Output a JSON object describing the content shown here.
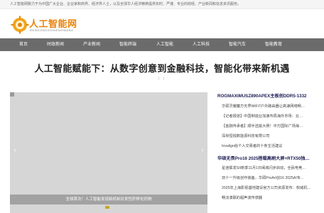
{
  "topbar": {
    "text": "人工智能网致力于为中国广大企业、企业家和商界、经济界人士，以及全球华人经济精英提供实时、严谨、专业的财经、产业新闻和信息资讯服务。"
  },
  "logo": {
    "name_cn": "人工智能网",
    "name_en": "RENGONGZHINENGWANG"
  },
  "nav": {
    "items": [
      "首页",
      "时政新闻",
      "产业新闻",
      "智能终端",
      "人工智能",
      "人工科技",
      "智能汽车",
      "智能教育"
    ]
  },
  "headline": {
    "title": "人工智能赋能下：从数字创意到金融科技，智能化带来新机遇",
    "dots": "|  |"
  },
  "slider": {
    "caption": "全球首次！人工智能发现新机制对发性肝移化药物",
    "prev": "‹",
    "next": "›"
  },
  "sidebar": {
    "sections": [
      {
        "title": "ROGMAXIMUSZ890APEX主板创DDR5-1332",
        "items": [
          "华硕灵耀魔方无界WiFi7户外路由器让高速网络畅…",
          "【记者报道】中国制造业加速布局海外市场：云…",
          "【金融传承者】顺手选拔大赛！中万国际广场海…",
          "深圳恒锐数能源科技有限公司",
          "Invalign给个人交易者的十条生活建议"
        ]
      },
      {
        "title": "华硕无畏Pro16 2025搭载高刷大屏+RTX50独…",
        "items": [
          "星途联发SII新季11月1日闽城闪步启动，全民电竞…",
          "双十一升级创作装备，华硕ProArt创16 2025AI专…",
          "2025年上海影视基地建设官方公司资源发布：权威机…",
          "畅淡澳联的超声波传感器"
        ]
      }
    ]
  },
  "colors": {
    "nav_bg": "#6b6b6b",
    "logo_orange": "#e8840d",
    "sidebar_title": "#1c1c55"
  }
}
